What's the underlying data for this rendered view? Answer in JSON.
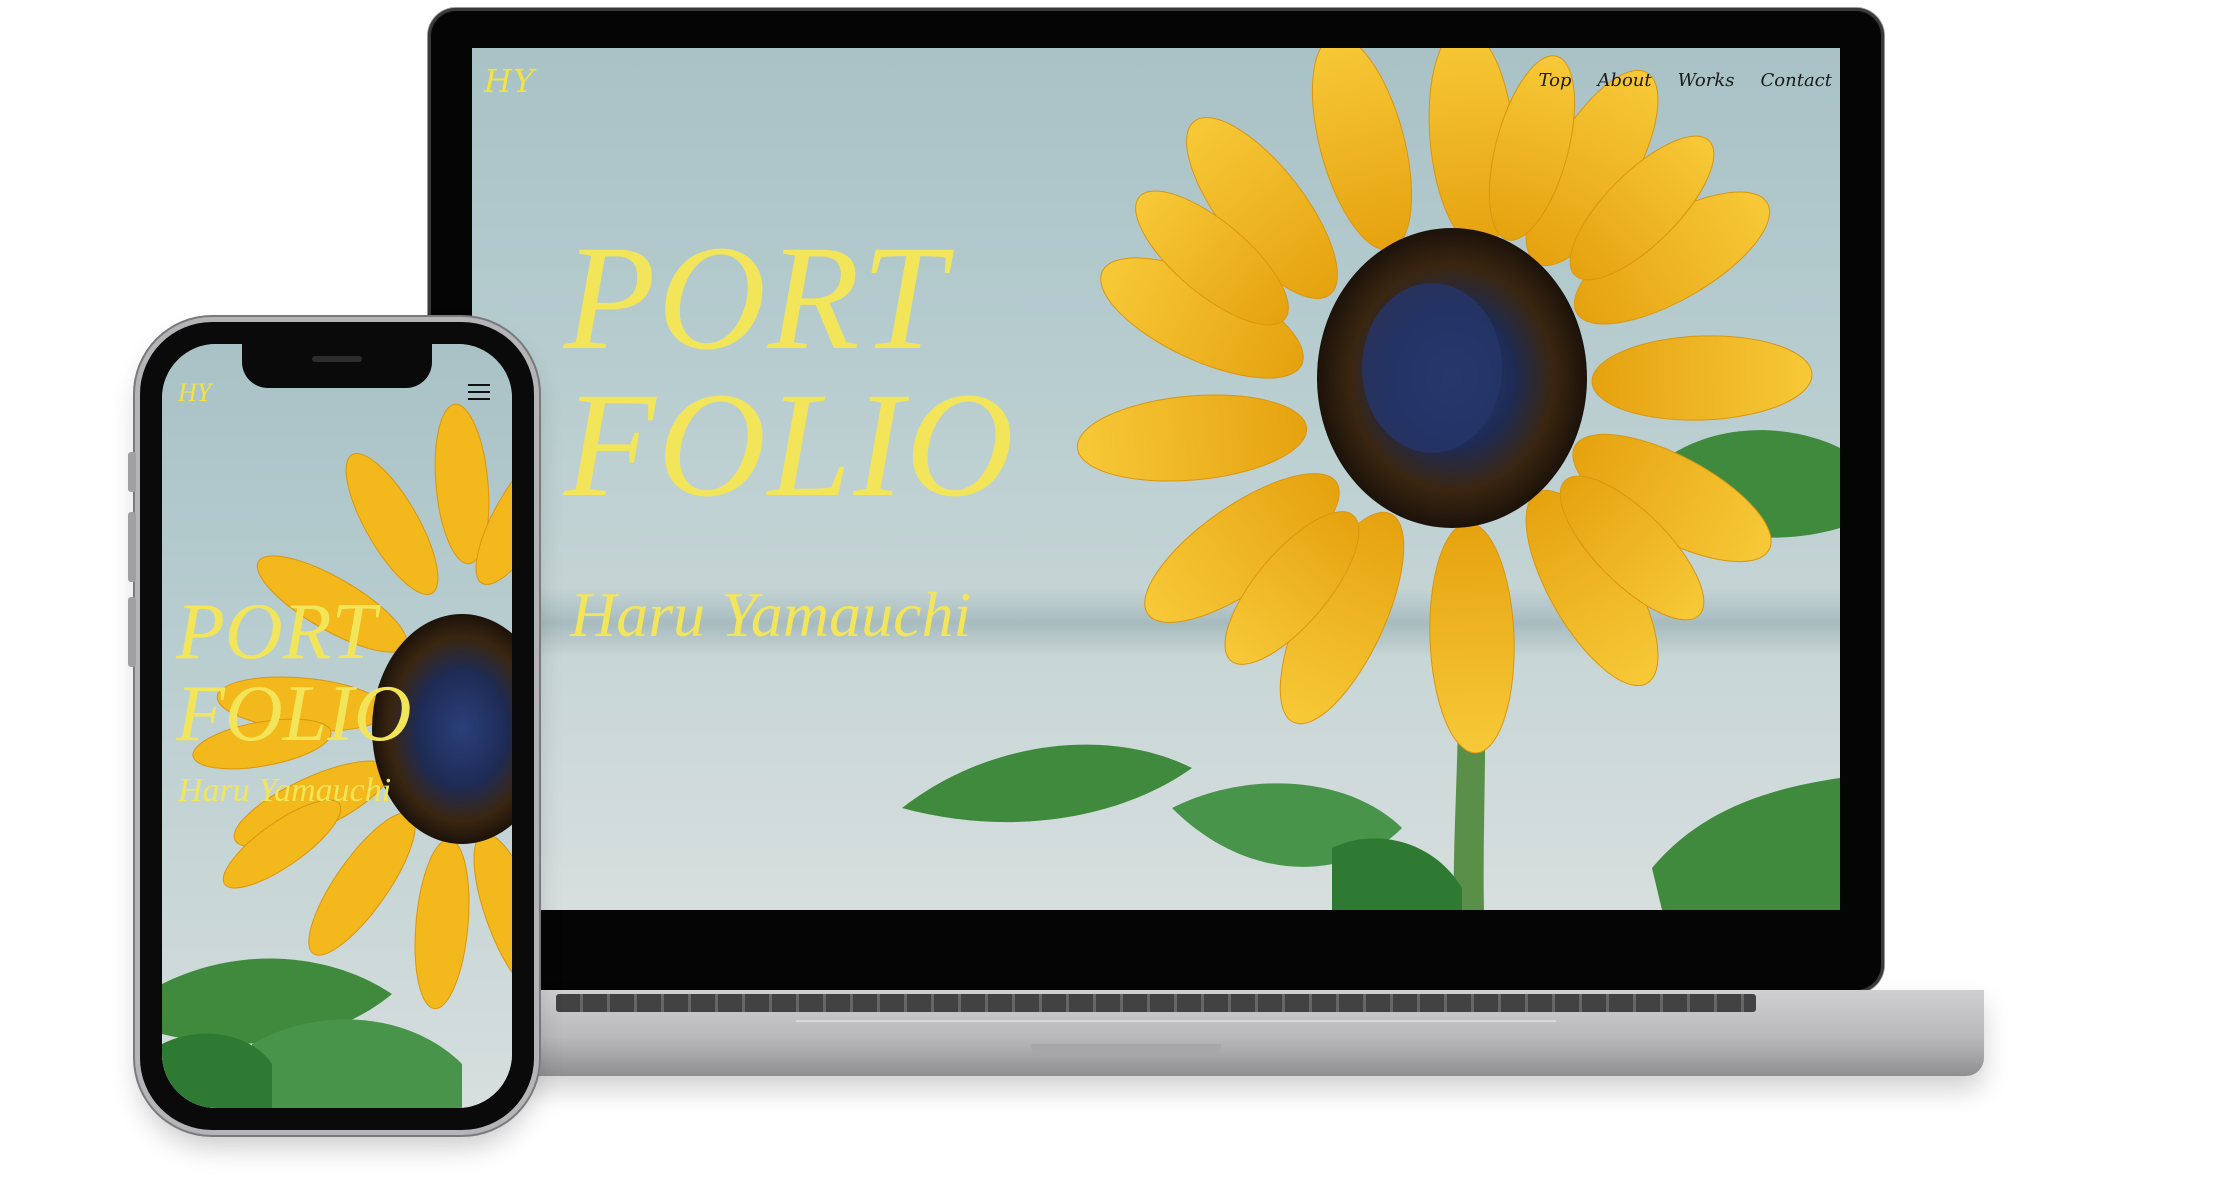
{
  "laptop_site": {
    "logo": "HY",
    "nav": [
      "Top",
      "About",
      "Works",
      "Contact"
    ],
    "hero_line_1": "PORT",
    "hero_line_2": "FOLIO",
    "name": "Haru Yamauchi"
  },
  "phone_site": {
    "logo": "HY",
    "menu_icon": "hamburger-icon",
    "hero_line_1": "PORT",
    "hero_line_2": "FOLIO",
    "name": "Haru Yamauchi"
  },
  "colors": {
    "accent_yellow": "#f3e55a",
    "sky": "#b6cccf",
    "petal": "#f2b81c",
    "center": "#2a1a0c",
    "leaf": "#3f8a3c"
  }
}
